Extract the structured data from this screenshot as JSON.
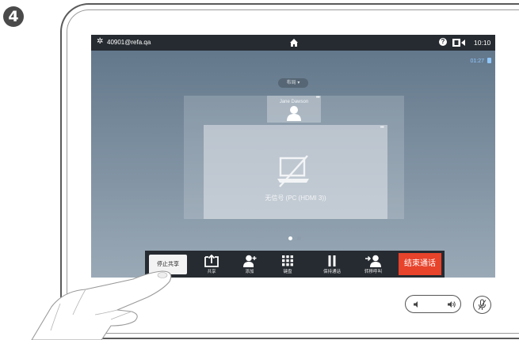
{
  "step": "4",
  "status_bar": {
    "uri": "40901@refa.qa",
    "help_label": "?",
    "time": "10:10"
  },
  "call": {
    "duration": "01:27"
  },
  "layout_button": {
    "label": "布局 ▾"
  },
  "participant": {
    "name": "Jane Dawson"
  },
  "presentation": {
    "no_signal_text": "无信号 (PC (HDMI 3))"
  },
  "page_indicator": {
    "count": 2,
    "active_index": 0
  },
  "toolbar": {
    "stop_sharing_label": "停止共享",
    "share_label": "共享",
    "add_label": "添加",
    "keypad_label": "键盘",
    "hold_label": "保持通话",
    "transfer_label": "转移呼叫",
    "end_call_label": "结束通话"
  },
  "colors": {
    "top_bar": "#262b31",
    "end_call": "#e8432b",
    "duration_text": "#8fc7ff",
    "page_dot_active": "#ffffff",
    "page_dot_inactive": "#8e9cab"
  },
  "icons": {
    "settings": "gear-icon",
    "home": "home-icon",
    "help": "help-icon",
    "self_view": "camera-icon",
    "lock": "lock-icon",
    "participant": "person-icon",
    "no_signal": "no-signal-icon",
    "share": "share-icon",
    "add": "add-participant-icon",
    "keypad": "keypad-icon",
    "hold": "pause-icon",
    "transfer": "transfer-icon",
    "volume_down": "volume-down-icon",
    "volume_up": "volume-up-icon",
    "mute": "microphone-mute-icon"
  }
}
